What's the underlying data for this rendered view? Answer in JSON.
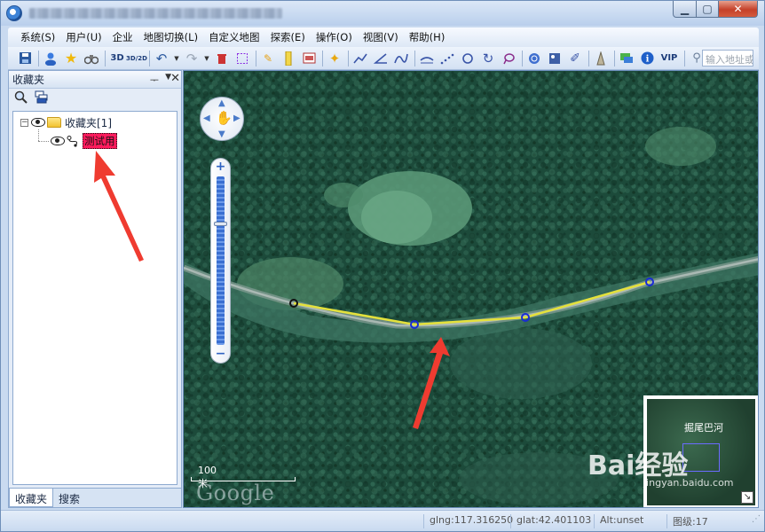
{
  "menu": [
    "系统(S)",
    "用户(U)",
    "企业",
    "地图切换(L)",
    "自定义地图",
    "探索(E)",
    "操作(O)",
    "视图(V)",
    "帮助(H)"
  ],
  "toolbar": {
    "label_3d": "3D",
    "label_3d2d": "3D/2D",
    "label_vip": "VIP",
    "address_placeholder": "输入地址或"
  },
  "panel": {
    "title": "收藏夹",
    "pin_glyph": "ᅮ",
    "tree": {
      "root_expander": "⊟",
      "root_label": "收藏夹[1]",
      "child_label": "测试用"
    },
    "tabs": [
      "收藏夹",
      "搜索"
    ]
  },
  "map": {
    "scale_label": "100米",
    "google_label": "Google",
    "overview_label": "掘尾巴河",
    "watermark": "Bai经验",
    "watermark_sub": "jingyan.baidu.com"
  },
  "status": {
    "glng": "glng:117.316250",
    "glat": "glat:42.401103",
    "alt": "Alt:unset",
    "zoom_level": "图级:17"
  }
}
